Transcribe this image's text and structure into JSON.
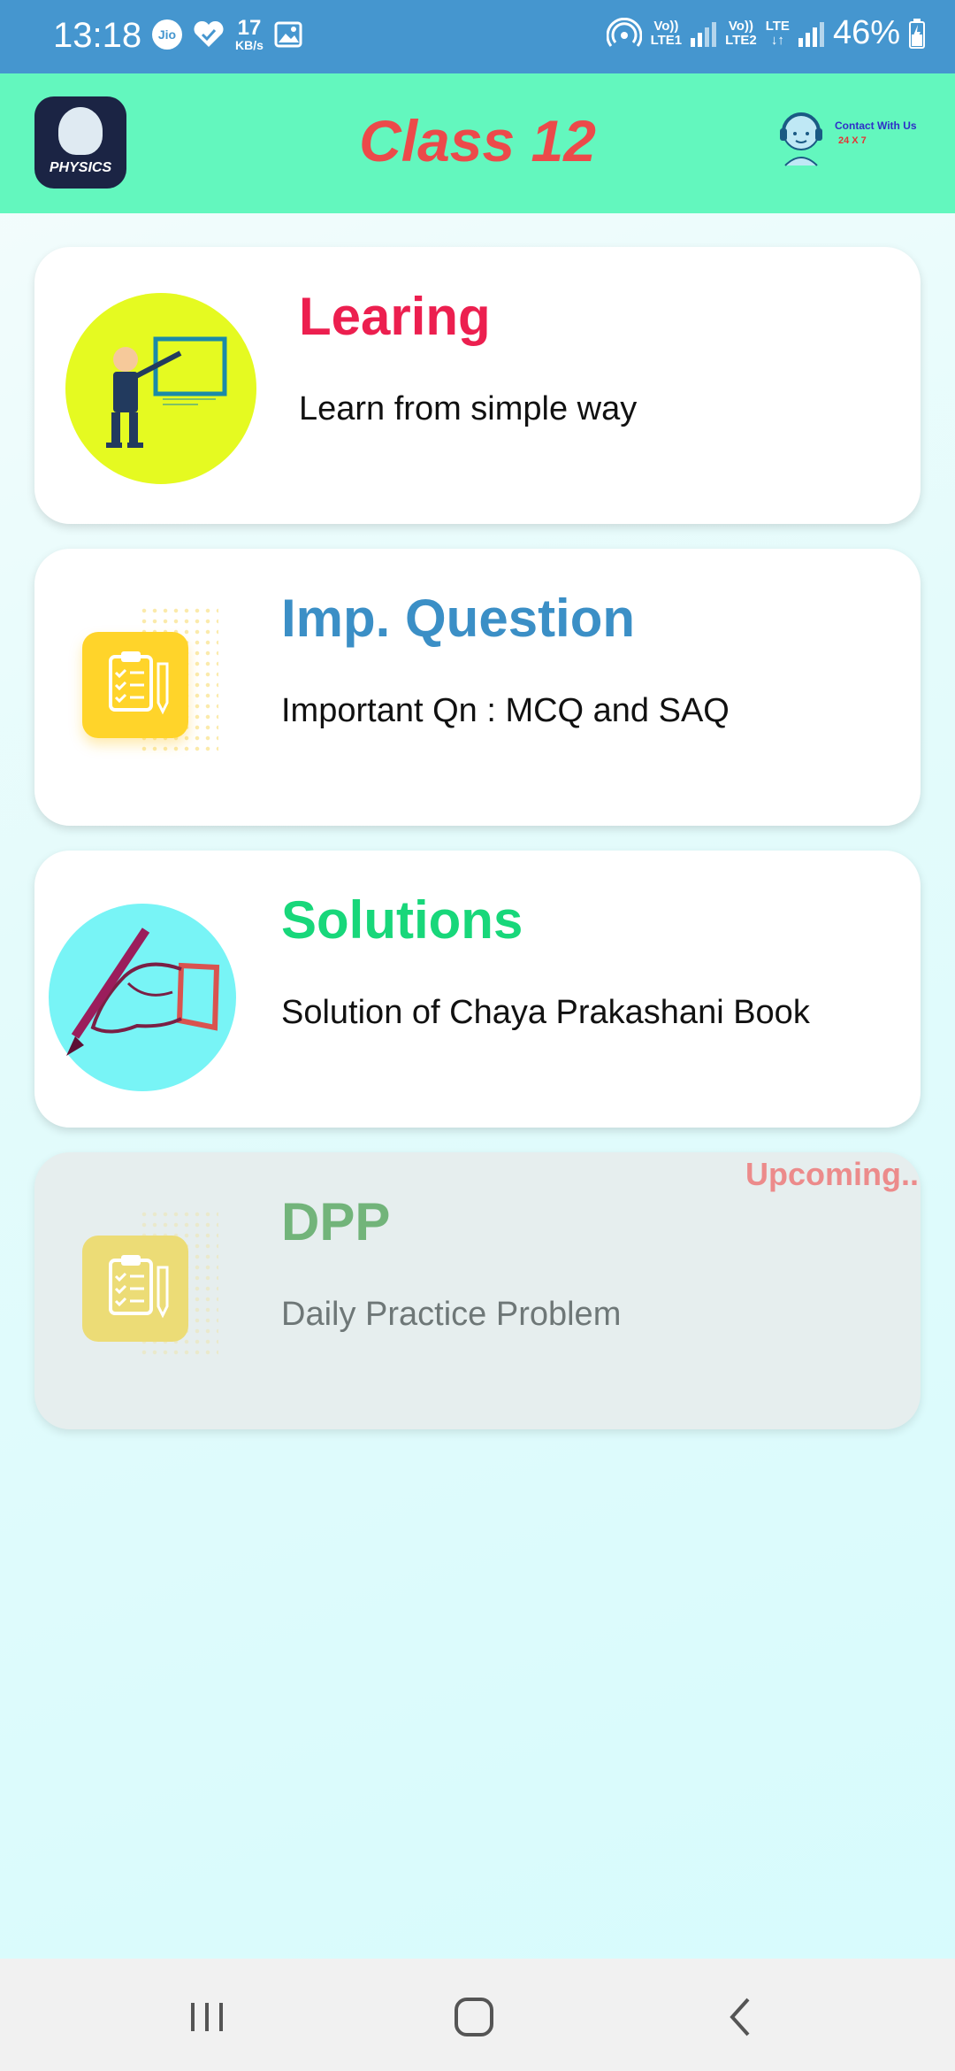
{
  "status_bar": {
    "time": "13:18",
    "carrier_icon": "Jio",
    "speed_value": "17",
    "speed_unit": "KB/s",
    "sim1_label_top": "Vo))",
    "sim1_label_bottom": "LTE1",
    "sim2_label_top": "Vo))",
    "sim2_label_bottom": "LTE2",
    "lte_label": "LTE",
    "battery": "46%",
    "icons": [
      "jio-icon",
      "heart-icon",
      "gallery-icon",
      "hotspot-icon",
      "signal-icon",
      "battery-icon"
    ]
  },
  "header": {
    "title": "Class 12",
    "logo_text": "PHYSICS",
    "contact_line1": "Contact With Us",
    "contact_line2": "24 X 7"
  },
  "cards": [
    {
      "title": "Learing",
      "subtitle": "Learn from simple way",
      "title_color": "#ec1f4f",
      "icon": "teacher-board-icon"
    },
    {
      "title": "Imp. Question",
      "subtitle": "Important Qn : MCQ and SAQ",
      "title_color": "#3b8fc6",
      "icon": "clipboard-icon"
    },
    {
      "title": "Solutions",
      "subtitle": "Solution of Chaya Prakashani Book",
      "title_color": "#18d77a",
      "icon": "writing-hand-icon"
    },
    {
      "title": "DPP",
      "subtitle": "Daily Practice Problem",
      "title_color": "#72b47a",
      "icon": "clipboard-icon",
      "badge": "Upcoming.."
    }
  ],
  "nav": [
    "recent-apps-icon",
    "home-icon",
    "back-icon"
  ]
}
